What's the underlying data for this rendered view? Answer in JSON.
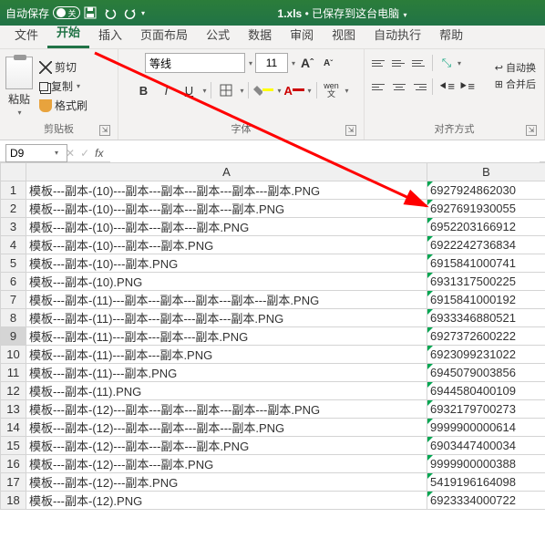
{
  "titlebar": {
    "autosave": "自动保存",
    "toggle": "关",
    "filename": "1.xls",
    "saved_msg": "已保存到这台电脑"
  },
  "tabs": {
    "file": "文件",
    "home": "开始",
    "insert": "插入",
    "layout": "页面布局",
    "formulas": "公式",
    "data": "数据",
    "review": "审阅",
    "view": "视图",
    "auto": "自动执行",
    "help": "帮助"
  },
  "ribbon": {
    "clipboard": {
      "paste": "粘贴",
      "cut": "剪切",
      "copy": "复制",
      "format_painter": "格式刷",
      "label": "剪贴板"
    },
    "font": {
      "name": "等线",
      "size": "11",
      "label": "字体",
      "wen": "wen"
    },
    "align": {
      "label": "对齐方式",
      "wrap": "自动换",
      "merge": "合并后"
    }
  },
  "fbar": {
    "namebox": "D9",
    "formula": ""
  },
  "columns": {
    "A": "A",
    "B": "B"
  },
  "chart_data": {
    "type": "table",
    "rows": [
      {
        "n": 1,
        "a": "模板---副本-(10)---副本---副本---副本---副本---副本.PNG",
        "b": "6927924862030"
      },
      {
        "n": 2,
        "a": "模板---副本-(10)---副本---副本---副本---副本.PNG",
        "b": "6927691930055"
      },
      {
        "n": 3,
        "a": "模板---副本-(10)---副本---副本---副本.PNG",
        "b": "6952203166912"
      },
      {
        "n": 4,
        "a": "模板---副本-(10)---副本---副本.PNG",
        "b": "6922242736834"
      },
      {
        "n": 5,
        "a": "模板---副本-(10)---副本.PNG",
        "b": "6915841000741"
      },
      {
        "n": 6,
        "a": "模板---副本-(10).PNG",
        "b": "6931317500225"
      },
      {
        "n": 7,
        "a": "模板---副本-(11)---副本---副本---副本---副本---副本.PNG",
        "b": "6915841000192"
      },
      {
        "n": 8,
        "a": "模板---副本-(11)---副本---副本---副本---副本.PNG",
        "b": "6933346880521"
      },
      {
        "n": 9,
        "a": "模板---副本-(11)---副本---副本---副本.PNG",
        "b": "6927372600222"
      },
      {
        "n": 10,
        "a": "模板---副本-(11)---副本---副本.PNG",
        "b": "6923099231022"
      },
      {
        "n": 11,
        "a": "模板---副本-(11)---副本.PNG",
        "b": "6945079003856"
      },
      {
        "n": 12,
        "a": "模板---副本-(11).PNG",
        "b": "6944580400109"
      },
      {
        "n": 13,
        "a": "模板---副本-(12)---副本---副本---副本---副本---副本.PNG",
        "b": "6932179700273"
      },
      {
        "n": 14,
        "a": "模板---副本-(12)---副本---副本---副本---副本.PNG",
        "b": "9999900000614"
      },
      {
        "n": 15,
        "a": "模板---副本-(12)---副本---副本---副本.PNG",
        "b": "6903447400034"
      },
      {
        "n": 16,
        "a": "模板---副本-(12)---副本---副本.PNG",
        "b": "9999900000388"
      },
      {
        "n": 17,
        "a": "模板---副本-(12)---副本.PNG",
        "b": "5419196164098"
      },
      {
        "n": 18,
        "a": "模板---副本-(12).PNG",
        "b": "6923334000722"
      }
    ]
  },
  "selected_row": 9
}
